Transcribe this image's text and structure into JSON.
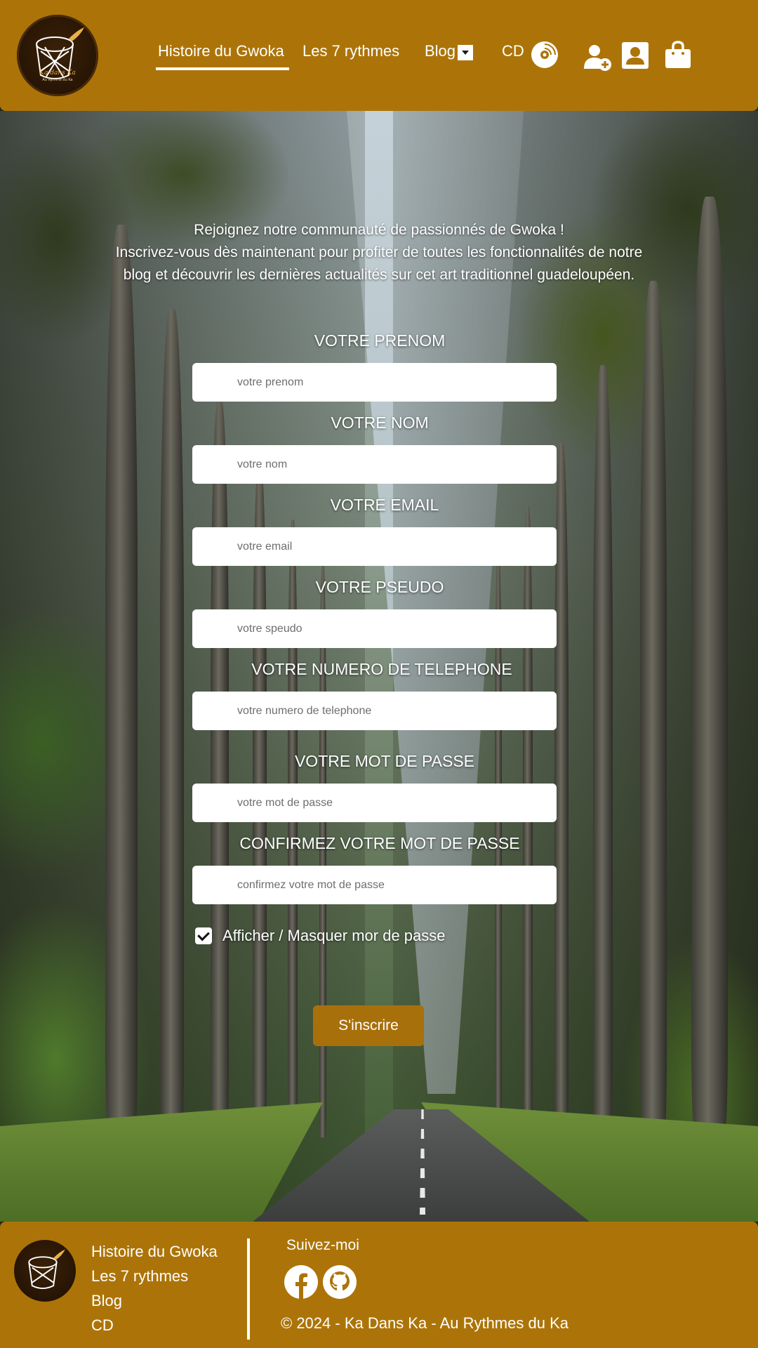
{
  "header": {
    "logo_text": "Ka dans Ka",
    "logo_sub": "Au Rythme du Ka",
    "nav": [
      {
        "label": "Histoire du Gwoka",
        "active": true
      },
      {
        "label": "Les 7 rythmes",
        "active": false
      },
      {
        "label": "Blog",
        "active": false
      },
      {
        "label": "CD",
        "active": false
      }
    ],
    "icons": [
      "cd-disc-icon",
      "add-user-icon",
      "account-icon",
      "shopping-bag-icon"
    ]
  },
  "form": {
    "intro_line1": "Rejoignez notre communauté de passionnés de Gwoka !",
    "intro_line2": "Inscrivez-vous dès maintenant pour profiter de toutes les fonctionnalités de notre",
    "intro_line3": "blog et découvrir les dernières actualités sur cet art traditionnel guadeloupéen.",
    "fields": [
      {
        "label": "VOTRE PRENOM",
        "placeholder": "votre prenom",
        "value": ""
      },
      {
        "label": "VOTRE NOM",
        "placeholder": "votre nom",
        "value": ""
      },
      {
        "label": "VOTRE EMAIL",
        "placeholder": "votre email",
        "value": ""
      },
      {
        "label": "VOTRE PSEUDO",
        "placeholder": "votre speudo",
        "value": ""
      },
      {
        "label": "VOTRE NUMERO DE TELEPHONE",
        "placeholder": "votre numero de telephone",
        "value": ""
      },
      {
        "label": "VOTRE MOT DE PASSE",
        "placeholder": "votre mot de passe",
        "value": ""
      },
      {
        "label": "CONFIRMEZ VOTRE MOT DE PASSE",
        "placeholder": "confirmez votre mot de passe",
        "value": ""
      }
    ],
    "show_password_label": "Afficher / Masquer mor de passe",
    "show_password_checked": true,
    "submit_label": "S'inscrire"
  },
  "footer": {
    "links": [
      "Histoire du Gwoka",
      "Les 7 rythmes",
      "Blog",
      "CD"
    ],
    "follow_label": "Suivez-moi",
    "social": [
      "facebook-icon",
      "github-icon"
    ],
    "copyright": "© 2024 - Ka Dans Ka - Au Rythmes du Ka"
  },
  "colors": {
    "brand": "#ac7408",
    "button": "#a8700a",
    "text": "#ffffff"
  }
}
